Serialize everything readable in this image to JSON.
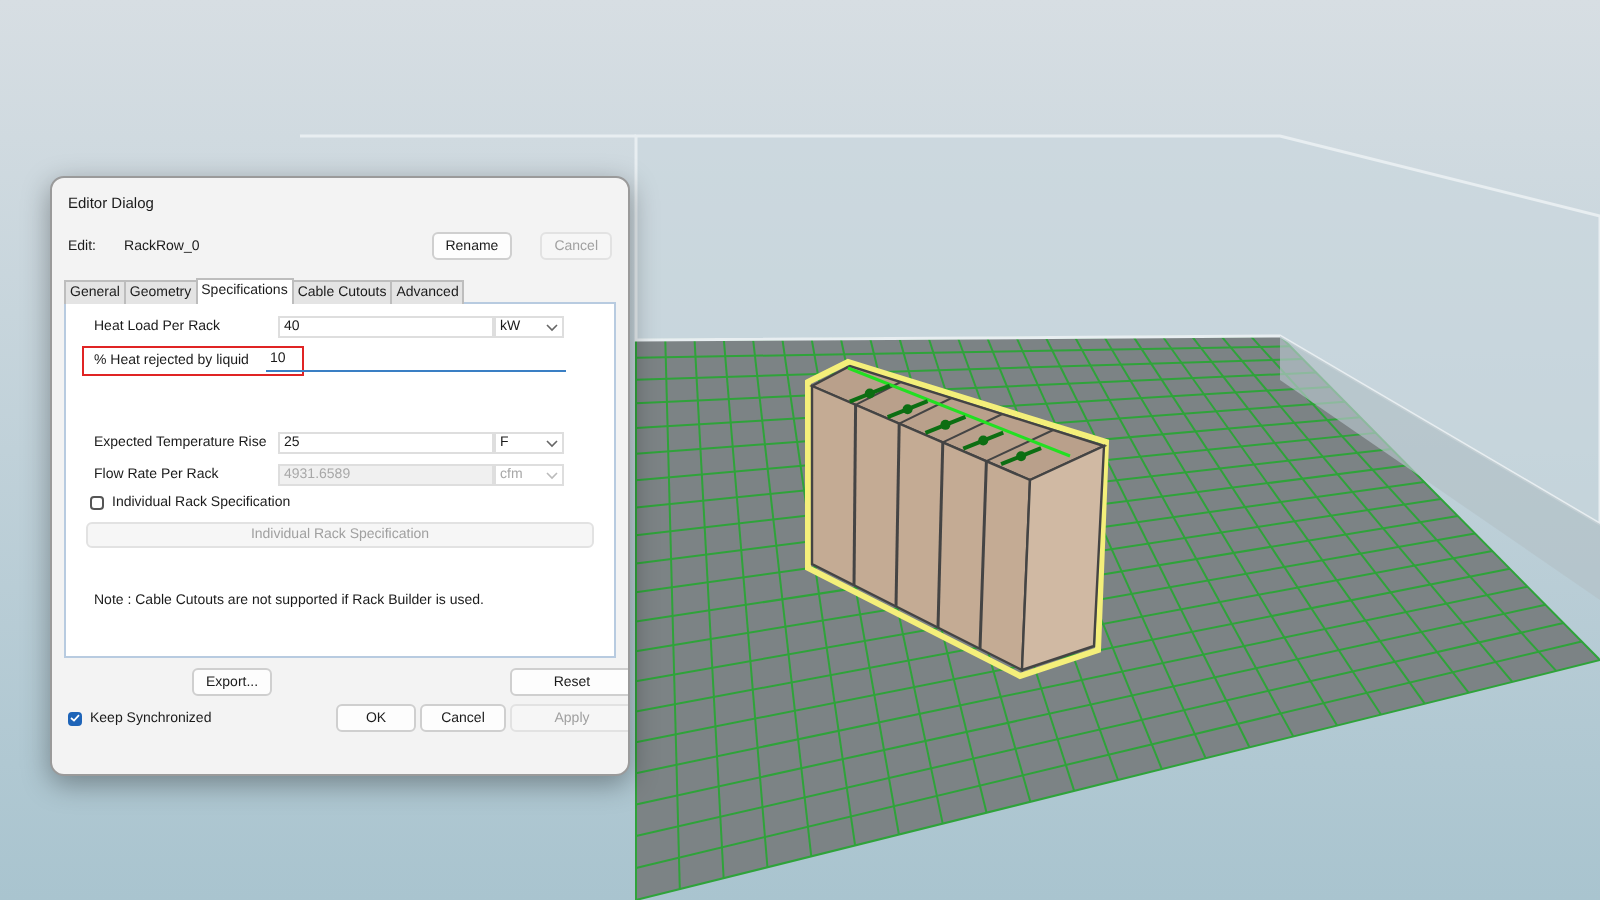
{
  "window": {
    "title": "Editor Dialog"
  },
  "edit": {
    "label": "Edit:",
    "value": "RackRow_0"
  },
  "header_buttons": [
    {
      "label": "Rename",
      "disabled": false
    },
    {
      "label": "Cancel",
      "disabled": true
    }
  ],
  "tabs": [
    {
      "label": "General",
      "selected": false
    },
    {
      "label": "Geometry",
      "selected": false
    },
    {
      "label": "Specifications",
      "selected": true
    },
    {
      "label": "Cable Cutouts",
      "selected": false
    },
    {
      "label": "Advanced",
      "selected": false
    }
  ],
  "fields": [
    {
      "kind": "input",
      "label": "Heat Load Per Rack",
      "value": "40",
      "unit": "kW",
      "disabled": false
    },
    {
      "kind": "line",
      "label": "% Heat rejected by liquid",
      "value": "10",
      "highlighted": true
    },
    {
      "kind": "input",
      "label": "Expected Temperature Rise",
      "value": "25",
      "unit": "F",
      "disabled": false
    },
    {
      "kind": "input",
      "label": "Flow Rate Per Rack",
      "value": "4931.6589",
      "unit": "cfm",
      "disabled": true
    }
  ],
  "individual_checkbox": {
    "label": "Individual Rack Specification",
    "checked": false
  },
  "individual_button": {
    "label": "Individual Rack Specification",
    "disabled": true
  },
  "note": "Note : Cable Cutouts are not supported if Rack Builder is used.",
  "export_button": {
    "label": "Export...",
    "disabled": false
  },
  "reset_button": {
    "label": "Reset",
    "disabled": false
  },
  "keep_synchronized": {
    "label": "Keep Synchronized",
    "checked": true
  },
  "footer_buttons": [
    {
      "label": "OK",
      "disabled": false
    },
    {
      "label": "Cancel",
      "disabled": false
    },
    {
      "label": "Apply",
      "disabled": true
    }
  ]
}
